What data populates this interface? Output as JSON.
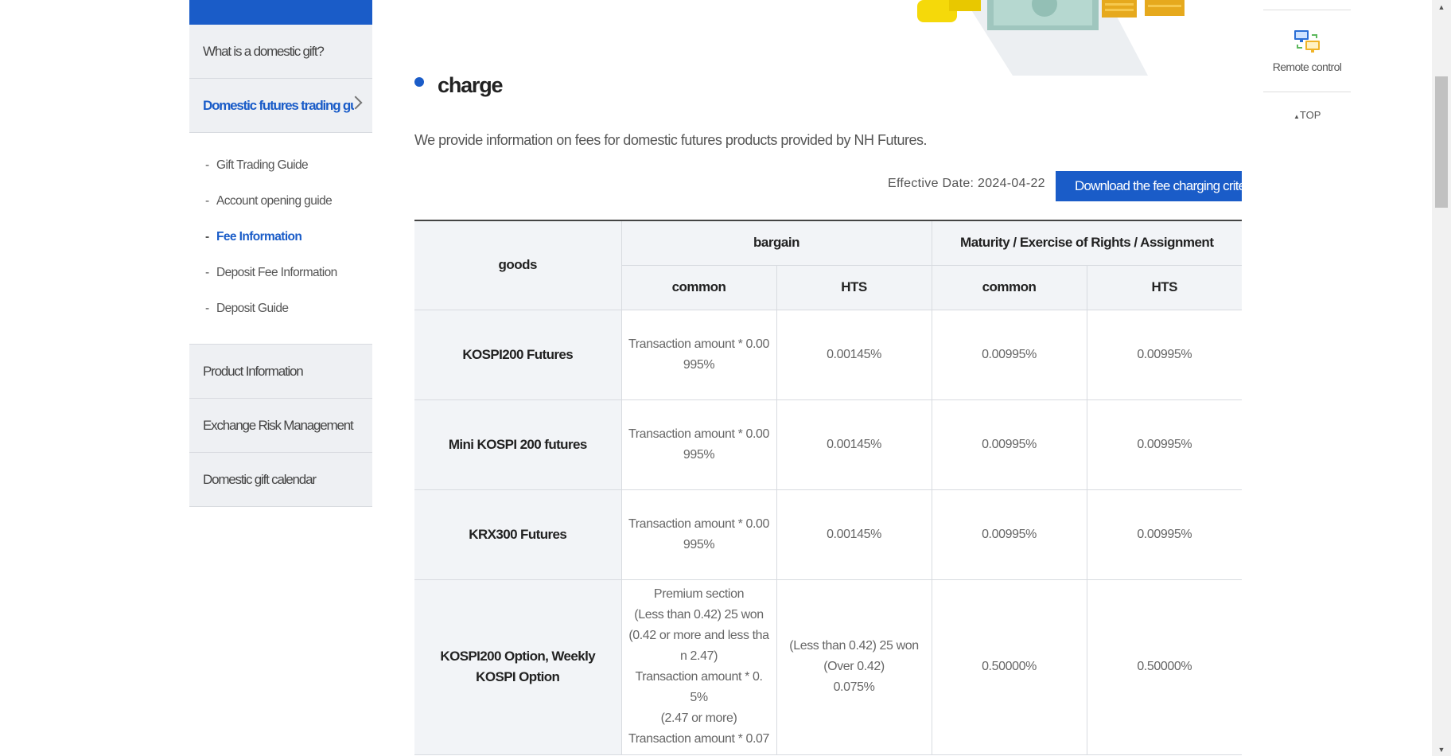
{
  "sidebar": {
    "items_top": [
      {
        "label": "What is a domestic gift?"
      },
      {
        "label": "Domestic futures trading gui"
      }
    ],
    "submenu": [
      {
        "label": "Gift Trading Guide"
      },
      {
        "label": "Account opening guide"
      },
      {
        "label": "Fee Information"
      },
      {
        "label": "Deposit Fee Information"
      },
      {
        "label": "Deposit Guide"
      }
    ],
    "items_bottom": [
      {
        "label": "Product Information"
      },
      {
        "label": "Exchange Risk Management"
      },
      {
        "label": "Domestic gift calendar"
      }
    ]
  },
  "main": {
    "section_title": "charge",
    "description": "We provide information on fees for domestic futures products provided by NH Futures.",
    "effective_date": "Effective Date: 2024-04-22",
    "download_label": "Download the fee charging criteria"
  },
  "table": {
    "headers": {
      "goods": "goods",
      "bargain": "bargain",
      "maturity": "Maturity / Exercise of Rights / Assignment",
      "common_1": "common",
      "hts_1": "HTS",
      "common_2": "common",
      "hts_2": "HTS"
    },
    "rows": [
      {
        "goods": "KOSPI200 Futures",
        "c1": "Transaction amount * 0.00\n995%",
        "h1": "0.00145%",
        "c2": "0.00995%",
        "h2": "0.00995%"
      },
      {
        "goods": "Mini KOSPI 200 futures",
        "c1": "Transaction amount * 0.00\n995%",
        "h1": "0.00145%",
        "c2": "0.00995%",
        "h2": "0.00995%"
      },
      {
        "goods": "KRX300 Futures",
        "c1": "Transaction amount * 0.00\n995%",
        "h1": "0.00145%",
        "c2": "0.00995%",
        "h2": "0.00995%"
      },
      {
        "goods": "KOSPI200 Option, Weekly KOSPI Option",
        "c1": "Premium section\n(Less than 0.42) 25 won\n(0.42 or more and less tha\nn 2.47)\nTransaction amount * 0.\n5%\n(2.47 or more)\nTransaction amount * 0.07",
        "h1": "(Less than 0.42) 25 won\n(Over 0.42)\n0.075%",
        "c2": "0.50000%",
        "h2": "0.50000%"
      }
    ]
  },
  "quick": {
    "remote_label": "Remote control",
    "top_label": "TOP"
  },
  "colors": {
    "accent": "#1a5cc8",
    "header_bg": "#f2f4f7",
    "sidebar_bg": "#eef0f3"
  }
}
